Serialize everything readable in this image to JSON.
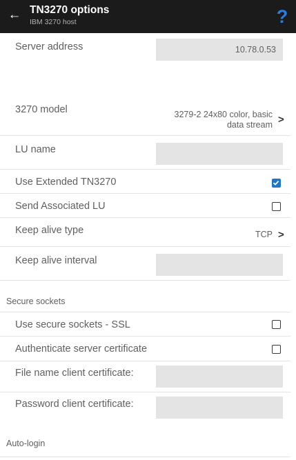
{
  "header": {
    "title": "TN3270 options",
    "subtitle": "IBM 3270 host",
    "help_glyph": "?",
    "back_glyph": "←"
  },
  "server_address": {
    "label": "Server address",
    "value": "10.78.0.53"
  },
  "model": {
    "label": "3270 model",
    "value_line1": "3279-2  24x80 color, basic",
    "value_line2": "data stream"
  },
  "lu_name": {
    "label": "LU name",
    "value": ""
  },
  "extended": {
    "label": "Use Extended TN3270",
    "checked": true
  },
  "associated_lu": {
    "label": "Send Associated LU",
    "checked": false
  },
  "keep_alive_type": {
    "label": "Keep alive type",
    "value": "TCP"
  },
  "keep_alive_interval": {
    "label": "Keep alive interval",
    "value": ""
  },
  "secure_sockets": {
    "section_title": "Secure sockets",
    "ssl": {
      "label": "Use secure sockets - SSL",
      "checked": false
    },
    "auth_cert": {
      "label": "Authenticate server certificate",
      "checked": false
    },
    "client_cert_file": {
      "label": "File name client certificate:",
      "value": ""
    },
    "client_cert_password": {
      "label": "Password client certificate:",
      "value": ""
    }
  },
  "auto_login": {
    "section_title": "Auto-login"
  },
  "colors": {
    "appbar": "#1b1b1b",
    "accent": "#1e77c8",
    "help": "#2a7de1",
    "field": "#e4e4e4"
  },
  "icons": {
    "back": "arrow-left-icon",
    "help": "help-icon",
    "chevron": "chevron-right-icon",
    "checkbox": "checkbox-icon"
  }
}
